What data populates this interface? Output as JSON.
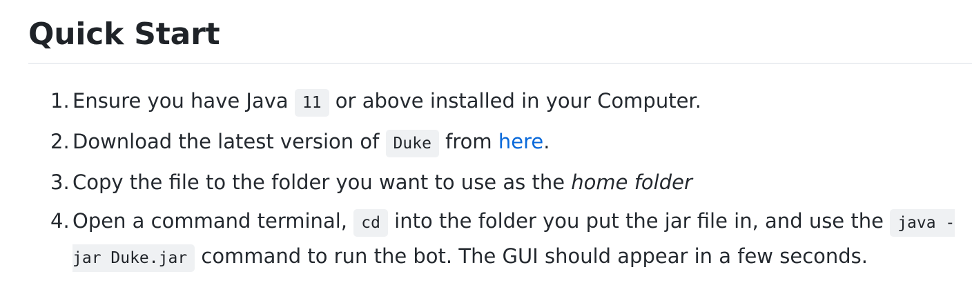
{
  "heading": "Quick Start",
  "steps": [
    {
      "number": "1.",
      "before": "Ensure you have Java ",
      "code": "11",
      "after": " or above installed in your Computer."
    },
    {
      "number": "2.",
      "before": "Download the latest version of ",
      "code": "Duke",
      "middle": " from ",
      "link_text": "here",
      "after": "."
    },
    {
      "number": "3.",
      "before": "Copy the file to the folder you want to use as the ",
      "emphasis": "home folder"
    },
    {
      "number": "4.",
      "before": "Open a command terminal, ",
      "code1": "cd",
      "middle": " into the folder you put the jar file in, and use the ",
      "code2": "java -jar Duke.jar",
      "after": " command to run the bot. The GUI should appear in a few seconds."
    }
  ],
  "colors": {
    "link": "#0969da",
    "code_background": "#eff1f3",
    "rule": "#d8dee4"
  }
}
